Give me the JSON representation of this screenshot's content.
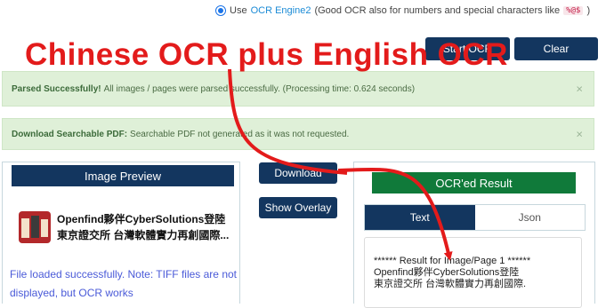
{
  "engine_option": {
    "prefix": "Use",
    "link": "OCR Engine2",
    "description": "(Good OCR also for numbers and special characters like",
    "chars": "%@$",
    "suffix": ")"
  },
  "top_buttons": {
    "start": "Start OCR",
    "clear": "Clear"
  },
  "overlay_title": "Chinese OCR plus English OCR",
  "alerts": [
    {
      "strong": "Parsed Successfully!",
      "text": "All images / pages were parsed successfully. (Processing time: 0.624 seconds)",
      "close": "×"
    },
    {
      "strong": "Download Searchable PDF:",
      "text": "Searchable PDF not generated as it was not requested.",
      "close": "×"
    }
  ],
  "image_preview": {
    "header": "Image Preview",
    "line1": "Openfind夥伴CyberSolutions登陸",
    "line2": "東京證交所 台灣軟體實力再創國際...",
    "loaded_line1": "File loaded successfully. Note: TIFF files are not",
    "loaded_line2": "displayed, but OCR works"
  },
  "actions": {
    "download": "Download",
    "show_overlay": "Show Overlay"
  },
  "result": {
    "header": "OCR'ed Result",
    "tabs": [
      "Text",
      "Json"
    ],
    "line1": "****** Result for Image/Page 1 ******",
    "line2": "Openfind夥伴CyberSolutions登陸",
    "line3": "東京證交所 台灣軟體實力再創國際."
  },
  "colors": {
    "navy": "#13365f",
    "green": "#107a3a",
    "arrow": "#e31b1b",
    "alert_bg": "#dff0d8"
  }
}
